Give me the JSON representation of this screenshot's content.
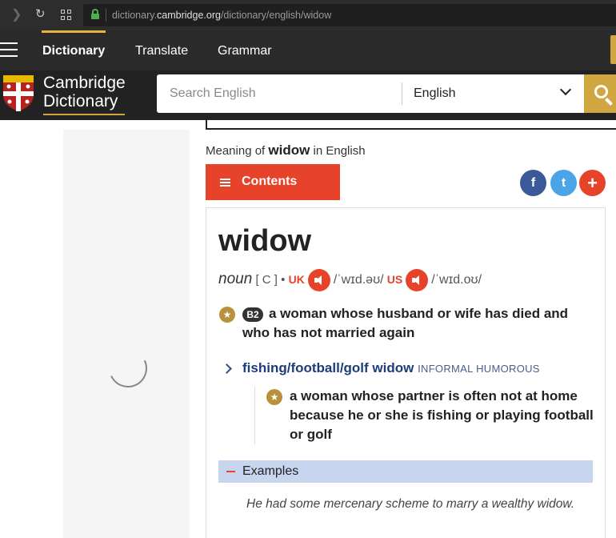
{
  "browser": {
    "url_prefix": "dictionary.",
    "url_domain": "cambridge.org",
    "url_path": "/dictionary/english/widow"
  },
  "nav": {
    "items": [
      {
        "label": "Dictionary",
        "active": true
      },
      {
        "label": "Translate",
        "active": false
      },
      {
        "label": "Grammar",
        "active": false
      }
    ]
  },
  "header": {
    "logo_line1": "Cambridge",
    "logo_line2": "Dictionary",
    "search_placeholder": "Search English",
    "language": "English"
  },
  "entry": {
    "meaning_prefix": "Meaning of",
    "meaning_word": "widow",
    "meaning_suffix": "in English",
    "contents_label": "Contents",
    "social": {
      "facebook": "f",
      "twitter": "t",
      "more": "+"
    },
    "headword": "widow",
    "pos": "noun",
    "grammar": "[ C ]",
    "bullet": "•",
    "uk_label": "UK",
    "uk_pron": "/ˈwɪd.əʊ/",
    "us_label": "US",
    "us_pron": "/ˈwɪd.oʊ/",
    "level": "B2",
    "definition": "a woman whose husband or wife has died and who has not married again",
    "phrase": "fishing/football/golf widow",
    "phrase_register": "INFORMAL HUMOROUS",
    "phrase_definition": "a woman whose partner is often not at home because he or she is fishing or playing football or golf",
    "examples_label": "Examples",
    "example_1": "He had some mercenary scheme to marry a wealthy widow."
  },
  "colors": {
    "accent_red": "#e6432a",
    "gold": "#d0a640",
    "header_bg": "#222222",
    "link_blue": "#1d3d7a"
  }
}
